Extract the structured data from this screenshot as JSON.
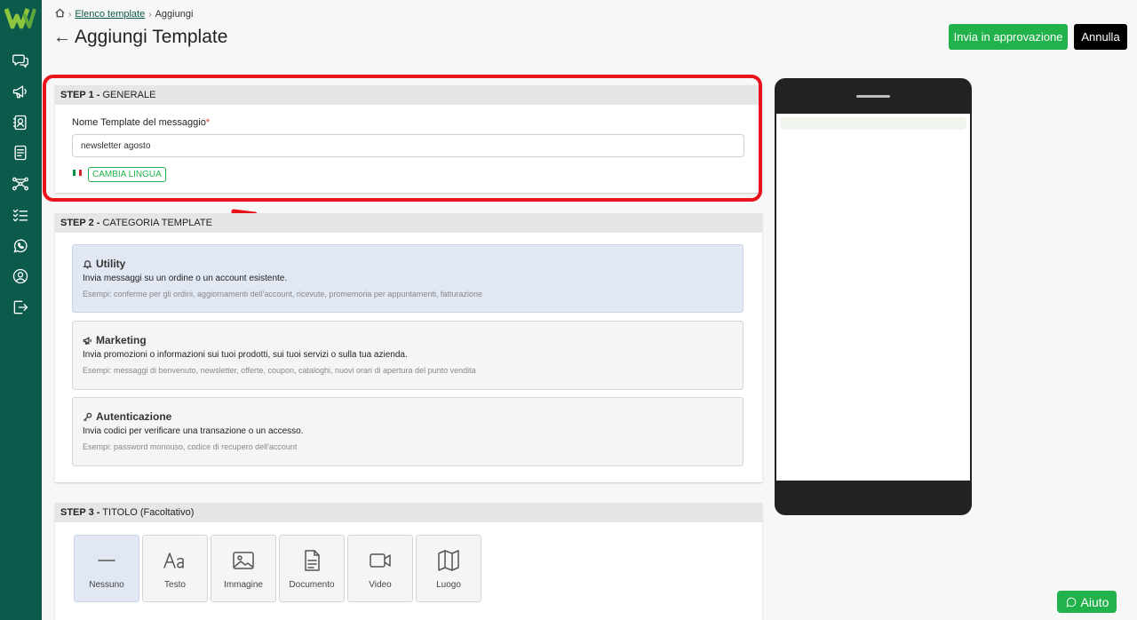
{
  "sidebar": {
    "items": [
      {
        "icon": "chat-icon"
      },
      {
        "icon": "megaphone-icon"
      },
      {
        "icon": "contacts-icon"
      },
      {
        "icon": "document-icon"
      },
      {
        "icon": "flow-icon"
      },
      {
        "icon": "checklist-icon"
      },
      {
        "icon": "whatsapp-icon"
      },
      {
        "icon": "account-icon"
      },
      {
        "icon": "logout-icon"
      }
    ]
  },
  "breadcrumb": {
    "link": "Elenco template",
    "current": "Aggiungi"
  },
  "header": {
    "title": "Aggiungi Template",
    "approve_label": "Invia in approvazione",
    "cancel_label": "Annulla"
  },
  "step1": {
    "step": "STEP 1 -",
    "title": "GENERALE",
    "field_label": "Nome Template del messaggio",
    "required_mark": "*",
    "field_value": "newsletter agosto",
    "lang_button": "CAMBIA LINGUA"
  },
  "step2": {
    "step": "STEP 2 -",
    "title": "CATEGORIA TEMPLATE",
    "categories": [
      {
        "name": "Utility",
        "description": "Invia messaggi su un ordine o un account esistente.",
        "examples": "Esempi: conferme per gli ordini, aggiornamenti dell'account, ricevute, promemoria per appuntamenti, fatturazione",
        "selected": true
      },
      {
        "name": "Marketing",
        "description": "Invia promozioni o informazioni sui tuoi prodotti, sui tuoi servizi o sulla tua azienda.",
        "examples": "Esempi: messaggi di benvenuto, newsletter, offerte, coupon, cataloghi, nuovi orari di apertura del punto vendita",
        "selected": false
      },
      {
        "name": "Autenticazione",
        "description": "Invia codici per verificare una transazione o un accesso.",
        "examples": "Esempi: password monouso, codice di recupero dell'account",
        "selected": false
      }
    ]
  },
  "step3": {
    "step": "STEP 3 -",
    "title": "TITOLO (Facoltativo)",
    "options": [
      "Nessuno",
      "Testo",
      "Immagine",
      "Documento",
      "Video",
      "Luogo"
    ],
    "selected": "Nessuno"
  },
  "help": {
    "label": "Aiuto"
  },
  "colors": {
    "sidebar": "#0c5a4b",
    "accent_green": "#22b24c",
    "highlight_red": "#e8131b",
    "selected_bg": "#e1e8f3"
  }
}
